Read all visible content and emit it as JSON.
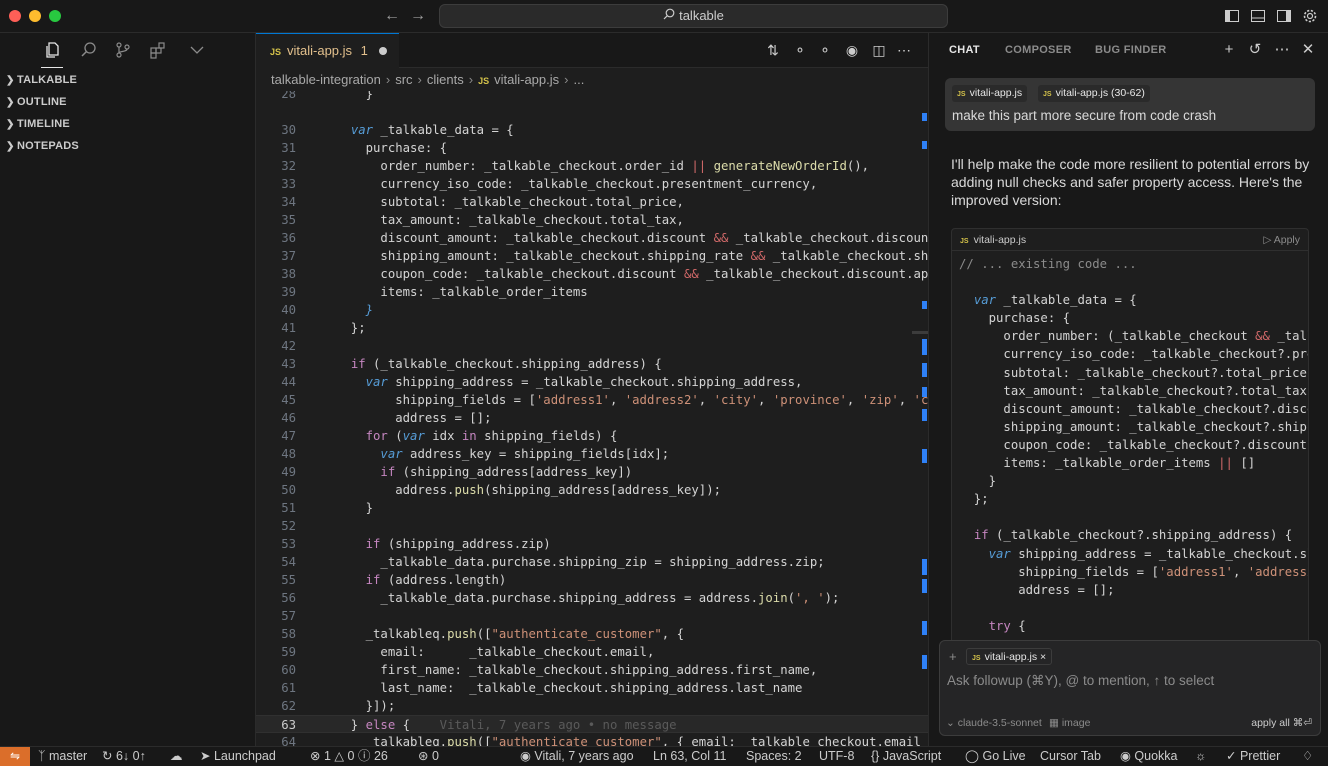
{
  "titlebar": {
    "search_text": "talkable",
    "icons": [
      "back-arrow-icon",
      "forward-arrow-icon",
      "search-icon",
      "toggle-primary-sidebar-icon",
      "toggle-panel-icon",
      "toggle-secondary-sidebar-icon",
      "gear-icon"
    ]
  },
  "sidebar": {
    "activity_icons": [
      "files-icon",
      "search-icon",
      "source-control-icon",
      "extensions-icon",
      "chevron-down-icon"
    ],
    "sections": [
      {
        "label": "TALKABLE"
      },
      {
        "label": "OUTLINE"
      },
      {
        "label": "TIMELINE"
      },
      {
        "label": "NOTEPADS"
      }
    ]
  },
  "editor": {
    "tab": {
      "icon_text": "JS",
      "label": "vitali-app.js",
      "problems": "1"
    },
    "breadcrumb": [
      "talkable-integration",
      "src",
      "clients",
      "vitali-app.js",
      "..."
    ],
    "breadcrumb_js": "JS",
    "blame": "Vitali, 7 years ago • no message",
    "current_line": 63
  },
  "chat": {
    "tabs": [
      "CHAT",
      "COMPOSER",
      "BUG FINDER"
    ],
    "user_message": {
      "pills": [
        "vitali-app.js",
        "vitali-app.js (30-62)"
      ],
      "pill_icon": "JS",
      "text": "make this part more secure from code crash"
    },
    "reply": "I'll help make the code more resilient to potential errors by adding null checks and safer property access. Here's the improved version:",
    "codeblock": {
      "filename": "vitali-app.js",
      "icon": "JS",
      "apply": "Apply"
    },
    "input": {
      "pill": "vitali-app.js",
      "pill_icon": "JS",
      "placeholder": "Ask followup (⌘Y), @ to mention, ↑ to select",
      "model": "claude-3.5-sonnet",
      "image": "image",
      "apply_all": "apply all ⌘⏎"
    }
  },
  "statusbar": {
    "branch": "master",
    "sync": "6↓ 0↑",
    "launchpad": "Launchpad",
    "errors": "1",
    "warnings": "0",
    "infos": "26",
    "ports": "0",
    "blame": "Vitali, 7 years ago",
    "position": "Ln 63, Col 11",
    "spaces": "Spaces: 2",
    "encoding": "UTF-8",
    "braces": "{}",
    "language": "JavaScript",
    "go_live": "Go Live",
    "cursor_tab": "Cursor Tab",
    "quokka": "Quokka",
    "prettier": "Prettier"
  }
}
